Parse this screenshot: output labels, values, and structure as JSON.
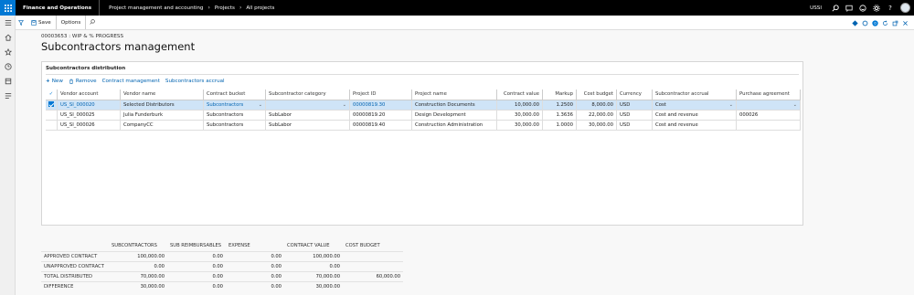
{
  "topbar": {
    "app_name": "Finance and Operations",
    "breadcrumbs": [
      "Project management and accounting",
      "Projects",
      "All projects"
    ],
    "company": "USSI"
  },
  "action_pane": {
    "save_label": "Save",
    "options_label": "Options"
  },
  "page": {
    "caption": "00003653 : WIP & % PROGRESS",
    "title": "Subcontractors management"
  },
  "section": {
    "title": "Subcontractors distribution",
    "toolbar": {
      "new_label": "New",
      "remove_label": "Remove",
      "contract_management_label": "Contract management",
      "subcontractors_accrual_label": "Subcontractors accrual"
    }
  },
  "grid": {
    "columns": [
      "Vendor account",
      "Vendor name",
      "Contract bucket",
      "Subcontractor category",
      "Project ID",
      "Project name",
      "Contract value",
      "Markup",
      "Cost budget",
      "Currency",
      "Subcontractor accrual",
      "Purchase agreement"
    ],
    "rows": [
      [
        "US_SI_000020",
        "Selected Distributors",
        "Subcontractors",
        "",
        "00000819.30",
        "Construction Documents",
        "10,000.00",
        "1.2500",
        "8,000.00",
        "USD",
        "Cost",
        ""
      ],
      [
        "US_SI_000025",
        "Julia Funderburk",
        "Subcontractors",
        "SubLabor",
        "00000819.20",
        "Design Development",
        "30,000.00",
        "1.3636",
        "22,000.00",
        "USD",
        "Cost and revenue",
        "000026"
      ],
      [
        "US_SI_000026",
        "CompanyCC",
        "Subcontractors",
        "SubLabor",
        "00000819.40",
        "Construction Administration",
        "30,000.00",
        "1.0000",
        "30,000.00",
        "USD",
        "Cost and revenue",
        ""
      ]
    ]
  },
  "summary": {
    "headers": [
      "SUBCONTRACTORS",
      "SUB REIMBURSABLES",
      "EXPENSE",
      "CONTRACT VALUE",
      "COST BUDGET"
    ],
    "rows": [
      [
        "APPROVED CONTRACT",
        "100,000.00",
        "0.00",
        "0.00",
        "100,000.00",
        ""
      ],
      [
        "UNAPPROVED CONTRACT",
        "0.00",
        "0.00",
        "0.00",
        "0.00",
        ""
      ],
      [
        "TOTAL DISTRIBUTED",
        "70,000.00",
        "0.00",
        "0.00",
        "70,000.00",
        "60,000.00"
      ],
      [
        "DIFFERENCE",
        "30,000.00",
        "0.00",
        "0.00",
        "30,000.00",
        ""
      ]
    ]
  },
  "colors": {
    "accent": "#0078d4",
    "topbar": "#000000",
    "selected_row": "#cfe4f7"
  }
}
